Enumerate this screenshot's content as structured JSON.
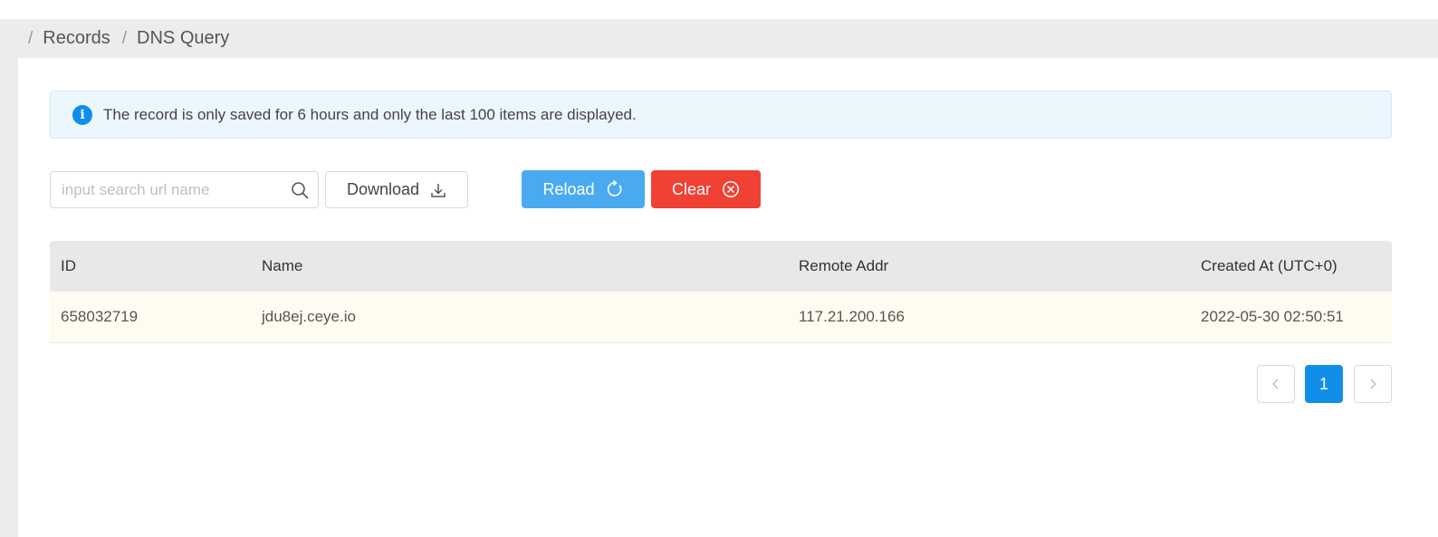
{
  "breadcrumb": {
    "separator": "/",
    "items": [
      "Records",
      "DNS Query"
    ]
  },
  "alert": {
    "icon": "info-icon",
    "text": "The record is only saved for 6 hours and only the last 100 items are displayed."
  },
  "toolbar": {
    "search_placeholder": "input search url name",
    "search_value": "",
    "download_label": "Download",
    "reload_label": "Reload",
    "clear_label": "Clear"
  },
  "table": {
    "columns": [
      "ID",
      "Name",
      "Remote Addr",
      "Created At (UTC+0)"
    ],
    "rows": [
      [
        "658032719",
        "jdu8ej.ceye.io",
        "117.21.200.166",
        "2022-05-30 02:50:51"
      ]
    ]
  },
  "pagination": {
    "prev": "<",
    "current": "1",
    "next": ">"
  },
  "colors": {
    "primary": "#108ee9",
    "reload": "#4aaaf0",
    "clear": "#f04134",
    "alert_bg": "#ecf6fd",
    "row_highlight": "#fefcf0"
  }
}
